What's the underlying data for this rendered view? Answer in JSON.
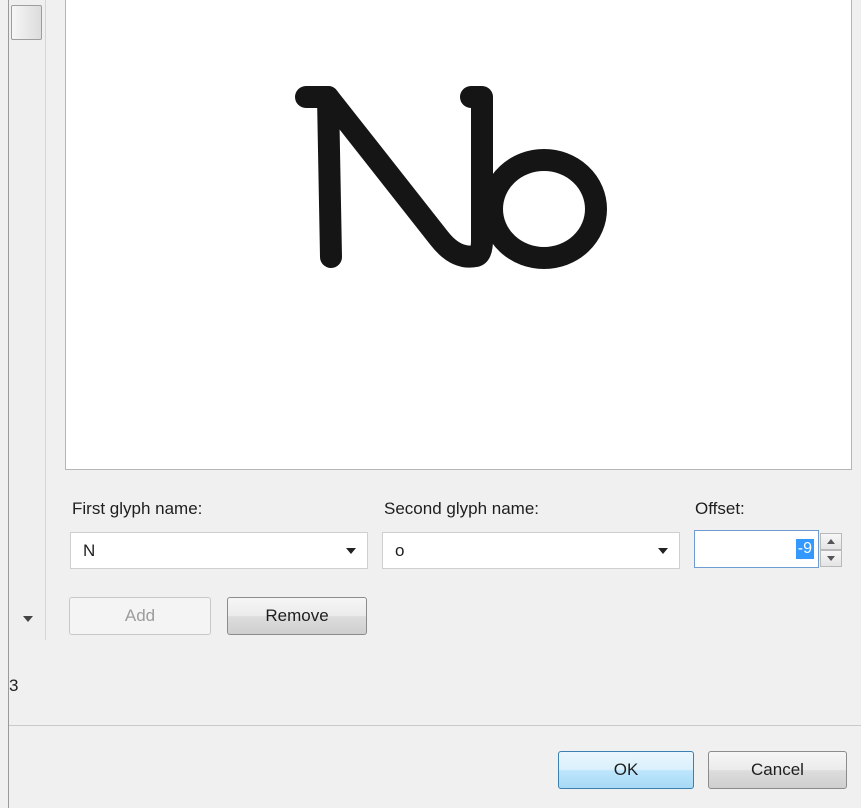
{
  "preview": {
    "sample_text": "No"
  },
  "fields": {
    "first_glyph": {
      "label": "First glyph name:",
      "value": "N"
    },
    "second_glyph": {
      "label": "Second glyph name:",
      "value": "o"
    },
    "offset": {
      "label": "Offset:",
      "value": "-9"
    }
  },
  "actions": {
    "add_label": "Add",
    "remove_label": "Remove"
  },
  "list": {
    "count": "3"
  },
  "dialog": {
    "ok_label": "OK",
    "cancel_label": "Cancel"
  },
  "icons": {
    "combo_arrow": "chevron-down-icon",
    "scroll_down": "scroll-down-arrow-icon",
    "spin_up": "spin-up-icon",
    "spin_down": "spin-down-icon"
  },
  "colors": {
    "selection": "#3399ff",
    "glyph": "#151515",
    "default_button": "#3c7fb1"
  }
}
